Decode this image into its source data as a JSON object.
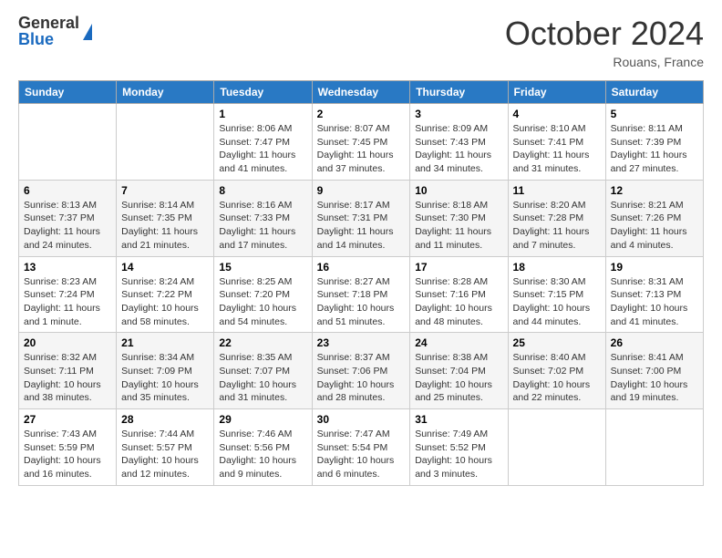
{
  "header": {
    "logo_general": "General",
    "logo_blue": "Blue",
    "title": "October 2024",
    "location": "Rouans, France"
  },
  "weekdays": [
    "Sunday",
    "Monday",
    "Tuesday",
    "Wednesday",
    "Thursday",
    "Friday",
    "Saturday"
  ],
  "weeks": [
    [
      {
        "day": "",
        "info": ""
      },
      {
        "day": "",
        "info": ""
      },
      {
        "day": "1",
        "info": "Sunrise: 8:06 AM\nSunset: 7:47 PM\nDaylight: 11 hours and 41 minutes."
      },
      {
        "day": "2",
        "info": "Sunrise: 8:07 AM\nSunset: 7:45 PM\nDaylight: 11 hours and 37 minutes."
      },
      {
        "day": "3",
        "info": "Sunrise: 8:09 AM\nSunset: 7:43 PM\nDaylight: 11 hours and 34 minutes."
      },
      {
        "day": "4",
        "info": "Sunrise: 8:10 AM\nSunset: 7:41 PM\nDaylight: 11 hours and 31 minutes."
      },
      {
        "day": "5",
        "info": "Sunrise: 8:11 AM\nSunset: 7:39 PM\nDaylight: 11 hours and 27 minutes."
      }
    ],
    [
      {
        "day": "6",
        "info": "Sunrise: 8:13 AM\nSunset: 7:37 PM\nDaylight: 11 hours and 24 minutes."
      },
      {
        "day": "7",
        "info": "Sunrise: 8:14 AM\nSunset: 7:35 PM\nDaylight: 11 hours and 21 minutes."
      },
      {
        "day": "8",
        "info": "Sunrise: 8:16 AM\nSunset: 7:33 PM\nDaylight: 11 hours and 17 minutes."
      },
      {
        "day": "9",
        "info": "Sunrise: 8:17 AM\nSunset: 7:31 PM\nDaylight: 11 hours and 14 minutes."
      },
      {
        "day": "10",
        "info": "Sunrise: 8:18 AM\nSunset: 7:30 PM\nDaylight: 11 hours and 11 minutes."
      },
      {
        "day": "11",
        "info": "Sunrise: 8:20 AM\nSunset: 7:28 PM\nDaylight: 11 hours and 7 minutes."
      },
      {
        "day": "12",
        "info": "Sunrise: 8:21 AM\nSunset: 7:26 PM\nDaylight: 11 hours and 4 minutes."
      }
    ],
    [
      {
        "day": "13",
        "info": "Sunrise: 8:23 AM\nSunset: 7:24 PM\nDaylight: 11 hours and 1 minute."
      },
      {
        "day": "14",
        "info": "Sunrise: 8:24 AM\nSunset: 7:22 PM\nDaylight: 10 hours and 58 minutes."
      },
      {
        "day": "15",
        "info": "Sunrise: 8:25 AM\nSunset: 7:20 PM\nDaylight: 10 hours and 54 minutes."
      },
      {
        "day": "16",
        "info": "Sunrise: 8:27 AM\nSunset: 7:18 PM\nDaylight: 10 hours and 51 minutes."
      },
      {
        "day": "17",
        "info": "Sunrise: 8:28 AM\nSunset: 7:16 PM\nDaylight: 10 hours and 48 minutes."
      },
      {
        "day": "18",
        "info": "Sunrise: 8:30 AM\nSunset: 7:15 PM\nDaylight: 10 hours and 44 minutes."
      },
      {
        "day": "19",
        "info": "Sunrise: 8:31 AM\nSunset: 7:13 PM\nDaylight: 10 hours and 41 minutes."
      }
    ],
    [
      {
        "day": "20",
        "info": "Sunrise: 8:32 AM\nSunset: 7:11 PM\nDaylight: 10 hours and 38 minutes."
      },
      {
        "day": "21",
        "info": "Sunrise: 8:34 AM\nSunset: 7:09 PM\nDaylight: 10 hours and 35 minutes."
      },
      {
        "day": "22",
        "info": "Sunrise: 8:35 AM\nSunset: 7:07 PM\nDaylight: 10 hours and 31 minutes."
      },
      {
        "day": "23",
        "info": "Sunrise: 8:37 AM\nSunset: 7:06 PM\nDaylight: 10 hours and 28 minutes."
      },
      {
        "day": "24",
        "info": "Sunrise: 8:38 AM\nSunset: 7:04 PM\nDaylight: 10 hours and 25 minutes."
      },
      {
        "day": "25",
        "info": "Sunrise: 8:40 AM\nSunset: 7:02 PM\nDaylight: 10 hours and 22 minutes."
      },
      {
        "day": "26",
        "info": "Sunrise: 8:41 AM\nSunset: 7:00 PM\nDaylight: 10 hours and 19 minutes."
      }
    ],
    [
      {
        "day": "27",
        "info": "Sunrise: 7:43 AM\nSunset: 5:59 PM\nDaylight: 10 hours and 16 minutes."
      },
      {
        "day": "28",
        "info": "Sunrise: 7:44 AM\nSunset: 5:57 PM\nDaylight: 10 hours and 12 minutes."
      },
      {
        "day": "29",
        "info": "Sunrise: 7:46 AM\nSunset: 5:56 PM\nDaylight: 10 hours and 9 minutes."
      },
      {
        "day": "30",
        "info": "Sunrise: 7:47 AM\nSunset: 5:54 PM\nDaylight: 10 hours and 6 minutes."
      },
      {
        "day": "31",
        "info": "Sunrise: 7:49 AM\nSunset: 5:52 PM\nDaylight: 10 hours and 3 minutes."
      },
      {
        "day": "",
        "info": ""
      },
      {
        "day": "",
        "info": ""
      }
    ]
  ]
}
